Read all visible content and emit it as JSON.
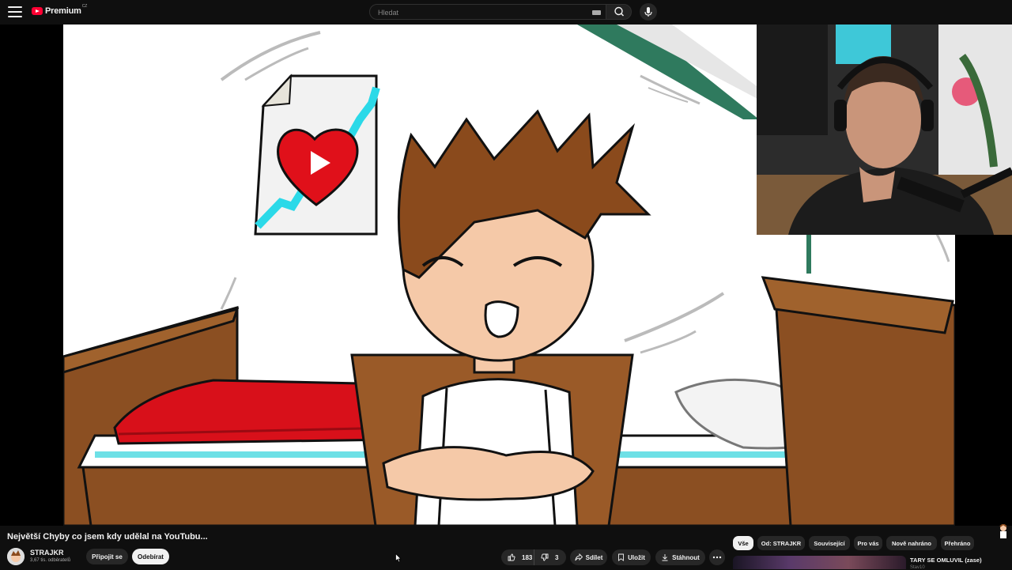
{
  "header": {
    "logo_text": "Premium",
    "logo_country": "CZ",
    "search_placeholder": "Hledat"
  },
  "video": {
    "title": "Největší Chyby co jsem kdy udělal na YouTubu...",
    "channel_name": "STRAJKR",
    "subscribers": "3,67 tis. odběratelů",
    "join_label": "Připojit se",
    "subscribe_label": "Odebírat",
    "likes": "183",
    "dislikes": "3",
    "share_label": "Sdílet",
    "save_label": "Uložit",
    "download_label": "Stáhnout"
  },
  "chips": [
    "Vše",
    "Od: STRAJKR",
    "Související",
    "Pro vás",
    "Nově nahráno",
    "Přehráno"
  ],
  "recommendation": {
    "title": "TARY SE OMLUVIL (zase)",
    "channel": "Stav10"
  },
  "colors": {
    "background": "#0f0f0f",
    "brand_red": "#ff0033",
    "chip_active": "#f1f1f1",
    "button_bg": "#272727"
  }
}
